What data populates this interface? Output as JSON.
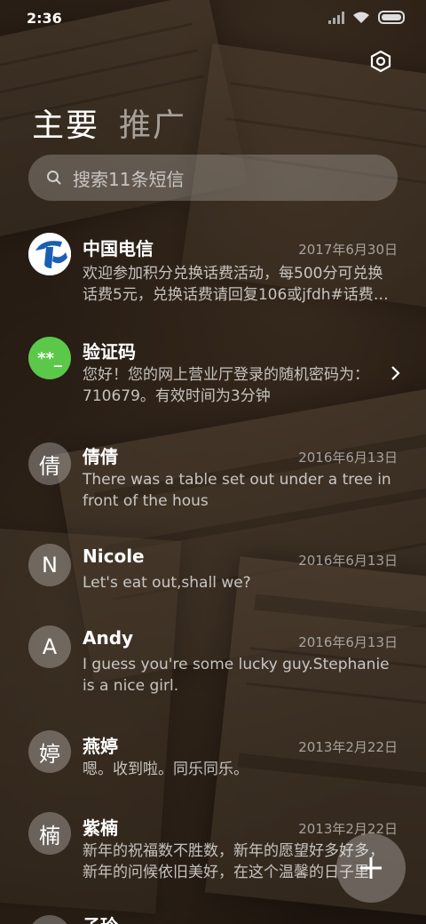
{
  "status_bar": {
    "time": "2:36"
  },
  "header": {
    "tabs": [
      {
        "label": "主要"
      },
      {
        "label": "推广"
      }
    ]
  },
  "search": {
    "placeholder": "搜索11条短信"
  },
  "messages": [
    {
      "avatar_text": "",
      "avatar_icon": "telecom-logo-icon",
      "name": "中国电信",
      "date": "2017年6月30日",
      "preview": "欢迎参加积分兑换话费活动，每500分可兑换话费5元，兑换话费请回复106或jfdh#话费…"
    },
    {
      "avatar_text": "**_",
      "name": "验证码",
      "date": "",
      "preview": "您好！您的网上营业厅登录的随机密码为：710679。有效时间为3分钟"
    },
    {
      "avatar_text": "倩",
      "name": "倩倩",
      "date": "2016年6月13日",
      "preview": "There was a table set out under a tree in front of the hous"
    },
    {
      "avatar_text": "N",
      "name": "Nicole",
      "date": "2016年6月13日",
      "preview": "Let's eat out,shall we?"
    },
    {
      "avatar_text": "A",
      "name": "Andy",
      "date": "2016年6月13日",
      "preview": "I guess you're some lucky guy.Stephanie is a nice girl."
    },
    {
      "avatar_text": "婷",
      "name": "燕婷",
      "date": "2013年2月22日",
      "preview": "嗯。收到啦。同乐同乐。"
    },
    {
      "avatar_text": "楠",
      "name": "紫楠",
      "date": "2013年2月22日",
      "preview": "新年的祝福数不胜数，新年的愿望好多好多，新年的问候依旧美好，在这个温馨的日子里"
    },
    {
      "avatar_text": "",
      "name": "子玲",
      "date": "",
      "preview": ""
    }
  ],
  "colors": {
    "verify_avatar": "#5cc84a",
    "telecom_blue": "#1a5fb4"
  }
}
